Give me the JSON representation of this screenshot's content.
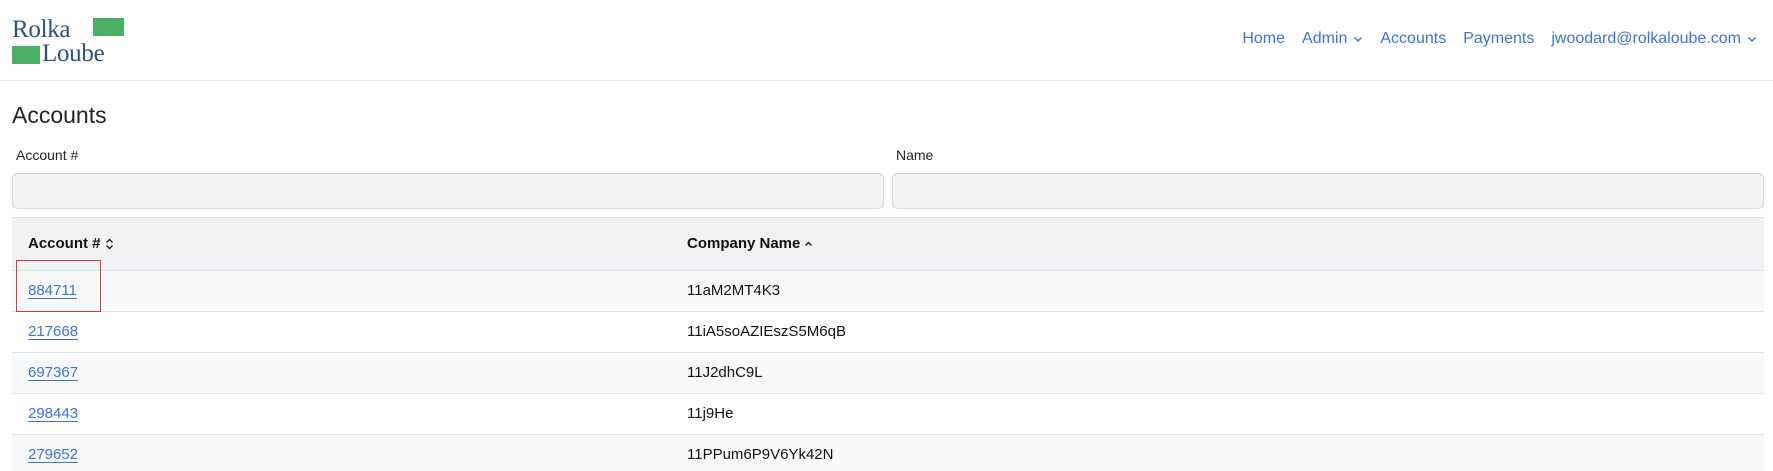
{
  "logo": {
    "line1": "Rolka",
    "line2": "Loube",
    "color": "#2e4f86",
    "accent": "#4caf65"
  },
  "nav": {
    "items": [
      {
        "label": "Home",
        "dropdown": false
      },
      {
        "label": "Admin",
        "dropdown": true
      },
      {
        "label": "Accounts",
        "dropdown": false
      },
      {
        "label": "Payments",
        "dropdown": false
      },
      {
        "label": "jwoodard@rolkaloube.com",
        "dropdown": true
      }
    ],
    "link_color": "#3b73d9"
  },
  "page": {
    "title": "Accounts"
  },
  "filters": {
    "account": {
      "label": "Account #",
      "value": "",
      "placeholder": ""
    },
    "name": {
      "label": "Name",
      "value": "",
      "placeholder": ""
    }
  },
  "table": {
    "columns": [
      {
        "label": "Account #",
        "sort": "unsorted"
      },
      {
        "label": "Company Name",
        "sort": "ascending"
      }
    ],
    "rows": [
      {
        "account": "884711",
        "name": "11aM2MT4K3"
      },
      {
        "account": "217668",
        "name": "11iA5soAZIEszS5M6qB"
      },
      {
        "account": "697367",
        "name": "11J2dhC9L"
      },
      {
        "account": "298443",
        "name": "11j9He"
      },
      {
        "account": "279652",
        "name": "11PPum6P9V6Yk42N"
      }
    ]
  }
}
